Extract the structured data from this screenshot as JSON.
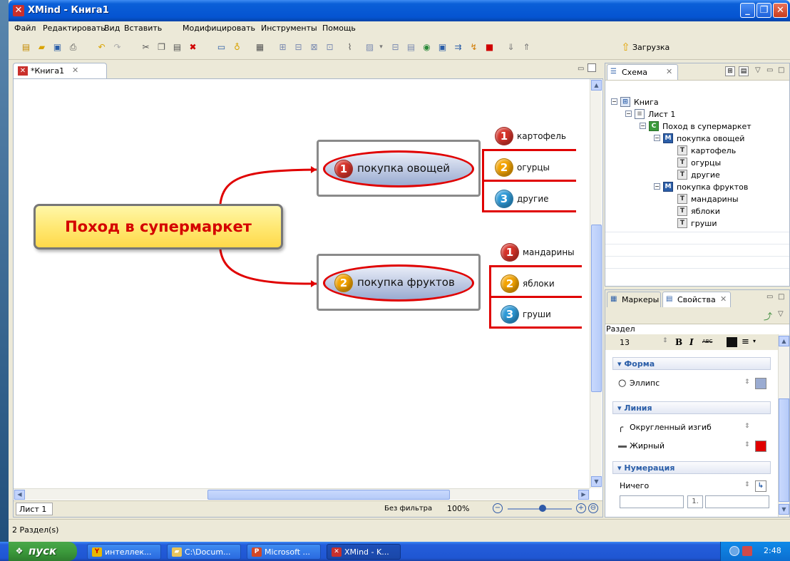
{
  "window": {
    "title": "XMind - Книга1"
  },
  "menu": [
    "Файл",
    "Редактировать",
    "Вид",
    "Вставить",
    "Модифицировать",
    "Инструменты",
    "Помощь"
  ],
  "toolbar": {
    "download_label": "Загрузка"
  },
  "editor": {
    "tab_label": "*Книга1",
    "sheet_tab": "Лист 1",
    "filter_label": "Без фильтра",
    "zoom": "100%"
  },
  "map": {
    "central": "Поход в супермаркет",
    "branches": [
      {
        "label": "покупка овощей",
        "number": "1",
        "children": [
          {
            "number": "1",
            "label": "картофель"
          },
          {
            "number": "2",
            "label": "огурцы"
          },
          {
            "number": "3",
            "label": "другие"
          }
        ]
      },
      {
        "label": "покупка фруктов",
        "number": "2",
        "children": [
          {
            "number": "1",
            "label": "мандарины"
          },
          {
            "number": "2",
            "label": "яблоки"
          },
          {
            "number": "3",
            "label": "груши"
          }
        ]
      }
    ]
  },
  "outline": {
    "tab_label": "Схема",
    "tree": [
      {
        "label": "Книга",
        "icon": "book-icon"
      },
      {
        "label": "Лист 1",
        "icon": "sheet-icon"
      },
      {
        "label": "Поход в супермаркет",
        "icon": "central-topic-icon",
        "icon_letter": "C"
      },
      {
        "label": "покупка овощей",
        "icon": "main-topic-icon",
        "icon_letter": "M"
      },
      {
        "label": "картофель",
        "icon": "topic-icon",
        "icon_letter": "T"
      },
      {
        "label": "огурцы",
        "icon": "topic-icon",
        "icon_letter": "T"
      },
      {
        "label": "другие",
        "icon": "topic-icon",
        "icon_letter": "T"
      },
      {
        "label": "покупка фруктов",
        "icon": "main-topic-icon",
        "icon_letter": "M"
      },
      {
        "label": "мандарины",
        "icon": "topic-icon",
        "icon_letter": "T"
      },
      {
        "label": "яблоки",
        "icon": "topic-icon",
        "icon_letter": "T"
      },
      {
        "label": "груши",
        "icon": "topic-icon",
        "icon_letter": "T"
      }
    ]
  },
  "properties": {
    "markers_tab": "Маркеры",
    "props_tab": "Свойства",
    "section": "Раздел",
    "font_size": "13",
    "abc_label": "ABC",
    "shape": {
      "header": "Форма",
      "value": "Эллипс",
      "color": "#9aabd1"
    },
    "line": {
      "header": "Линия",
      "style": "Округленный изгиб",
      "weight": "Жирный",
      "color": "#e00000"
    },
    "numbering": {
      "header": "Нумерация",
      "value": "Ничего",
      "format": "1."
    }
  },
  "status": {
    "text": "2 Раздел(s)"
  },
  "taskbar": {
    "start": "пуск",
    "tasks": [
      "интеллек...",
      "C:\\Docum...",
      "Microsoft ...",
      "XMind - K..."
    ],
    "clock": "2:48"
  },
  "colors": {
    "accent_red": "#e00000",
    "title_blue": "#0554d1",
    "central_text": "#d40000"
  }
}
